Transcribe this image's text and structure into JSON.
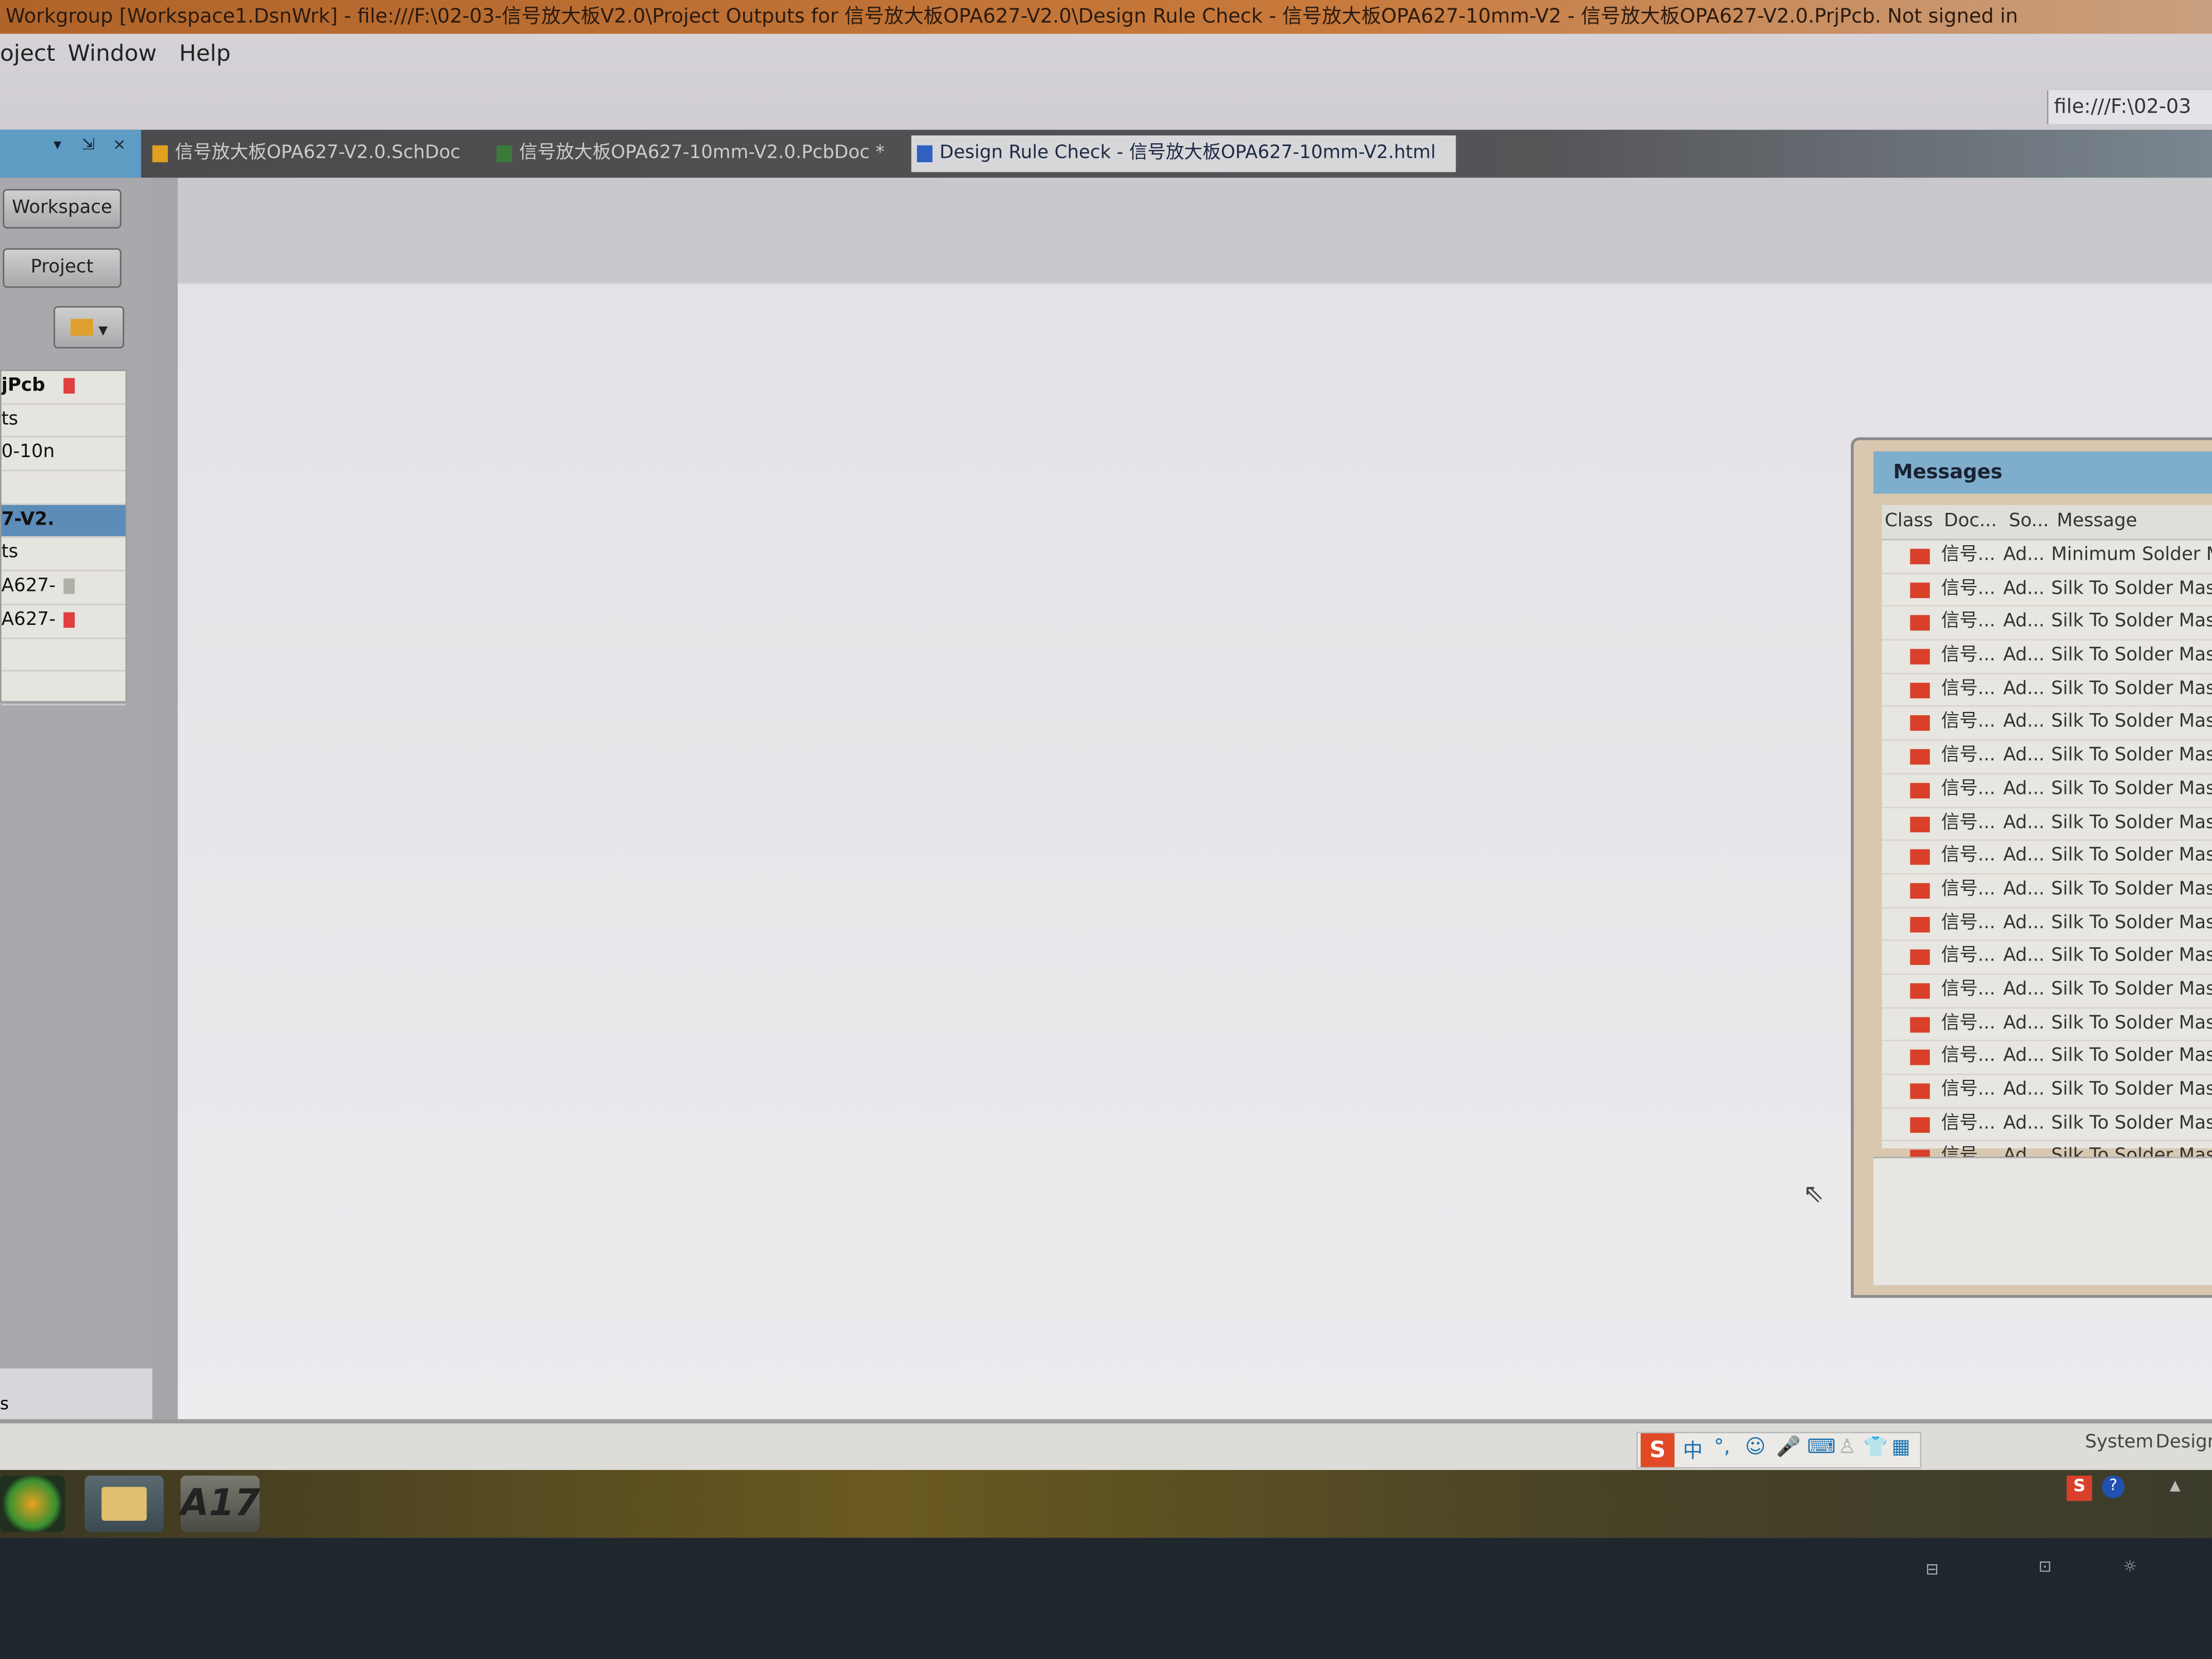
{
  "window": {
    "title": "Workgroup [Workspace1.DsnWrk] - file:///F:\\02-03-信号放大板V2.0\\Project Outputs for 信号放大板OPA627-V2.0\\Design Rule Check - 信号放大板OPA627-10mm-V2 - 信号放大板OPA627-V2.0.PrjPcb. Not signed in"
  },
  "menu": [
    "oject",
    "Window",
    "Help"
  ],
  "address": "file:///F:\\02-03",
  "tabs": [
    {
      "label": "信号放大板OPA627-V2.0.SchDoc",
      "icon": "schematic-icon",
      "active": false
    },
    {
      "label": "信号放大板OPA627-10mm-V2.0.PcbDoc *",
      "icon": "pcb-icon",
      "active": false
    },
    {
      "label": "Design Rule Check - 信号放大板OPA627-10mm-V2.html",
      "icon": "html-doc-icon",
      "active": true
    }
  ],
  "panel": {
    "controls": [
      "▾",
      "⇲",
      "×"
    ],
    "workspace_button": "Workspace",
    "project_button": "Project",
    "tree": [
      {
        "label": "jPcb",
        "bold": true,
        "icon": "red-doc"
      },
      {
        "label": "ts"
      },
      {
        "label": "0-10n"
      },
      {
        "label": ""
      },
      {
        "label": "7-V2.",
        "selected": true
      },
      {
        "label": "ts"
      },
      {
        "label": "A627-",
        "icon": "gray-doc"
      },
      {
        "label": "A627-",
        "icon": "red-doc"
      },
      {
        "label": ""
      },
      {
        "label": ""
      }
    ],
    "bottom_label": "s"
  },
  "messages": {
    "title": "Messages",
    "columns": [
      "Class",
      "Doc...",
      "So...",
      "Message"
    ],
    "rows": [
      {
        "doc": "信号...",
        "source": "Ad...",
        "message": "Minimum Solder M"
      },
      {
        "doc": "信号...",
        "source": "Ad...",
        "message": "Silk To Solder Mas"
      },
      {
        "doc": "信号...",
        "source": "Ad...",
        "message": "Silk To Solder Mas"
      },
      {
        "doc": "信号...",
        "source": "Ad...",
        "message": "Silk To Solder Mas"
      },
      {
        "doc": "信号...",
        "source": "Ad...",
        "message": "Silk To Solder Mask"
      },
      {
        "doc": "信号...",
        "source": "Ad...",
        "message": "Silk To Solder Mask"
      },
      {
        "doc": "信号...",
        "source": "Ad...",
        "message": "Silk To Solder Mask"
      },
      {
        "doc": "信号...",
        "source": "Ad...",
        "message": "Silk To Solder Mask"
      },
      {
        "doc": "信号...",
        "source": "Ad...",
        "message": "Silk To Solder Mask"
      },
      {
        "doc": "信号...",
        "source": "Ad...",
        "message": "Silk To Solder Mask"
      },
      {
        "doc": "信号...",
        "source": "Ad...",
        "message": "Silk To Solder Mask"
      },
      {
        "doc": "信号...",
        "source": "Ad...",
        "message": "Silk To Solder Mask"
      },
      {
        "doc": "信号...",
        "source": "Ad...",
        "message": "Silk To Solder Mask."
      },
      {
        "doc": "信号...",
        "source": "Ad...",
        "message": "Silk To Solder Mask."
      },
      {
        "doc": "信号...",
        "source": "Ad...",
        "message": "Silk To Solder Mask."
      },
      {
        "doc": "信号...",
        "source": "Ad...",
        "message": "Silk To Solder Mask..."
      },
      {
        "doc": "信号...",
        "source": "Ad...",
        "message": "Silk To Solder Mask..."
      },
      {
        "doc": "信号...",
        "source": "Ad...",
        "message": "Silk To Solder Mask..."
      },
      {
        "doc": "信号...",
        "source": "Ad...",
        "message": "Silk To Solder Mask..."
      }
    ]
  },
  "statusbar": {
    "ime": [
      "S",
      "中",
      "°,",
      "☺",
      "🎤",
      "⌨",
      "♙",
      "👕",
      "▦"
    ],
    "buttons": [
      "System",
      "Design"
    ]
  },
  "taskbar": {
    "apps": [
      "start-orb",
      "file-explorer",
      "altium-designer-17"
    ],
    "altium_label": "A17",
    "tray": [
      "sogou-ime",
      "help",
      "network"
    ]
  },
  "colors": {
    "error": "#d8402a",
    "selection": "#5c8cb8",
    "panel_title": "#7eaecb"
  }
}
